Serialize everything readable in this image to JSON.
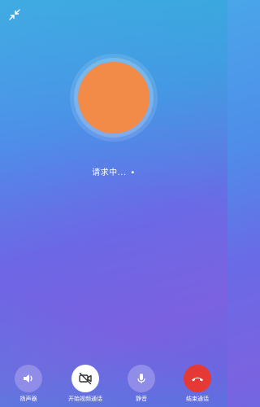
{
  "call": {
    "status_text": "请求中...",
    "dot": "•"
  },
  "controls": {
    "speaker_label": "扬声器",
    "video_label": "开始视频通话",
    "mute_label": "静音",
    "end_label": "结束通话"
  },
  "colors": {
    "avatar": "#f28a48",
    "control_bg": "#8f8de8",
    "video_bg": "#ffffff",
    "end_bg": "#e53935"
  },
  "icons": {
    "minimize": "minimize-icon",
    "speaker": "speaker-icon",
    "video": "video-off-icon",
    "mute": "microphone-icon",
    "end": "hangup-icon"
  }
}
